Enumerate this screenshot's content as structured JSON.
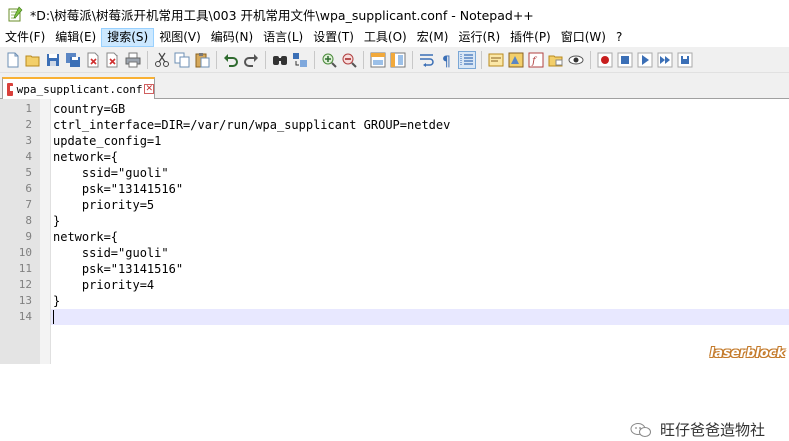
{
  "window": {
    "title": "*D:\\树莓派\\树莓派开机常用工具\\003 开机常用文件\\wpa_supplicant.conf - Notepad++"
  },
  "menu": {
    "items": [
      "文件(F)",
      "编辑(E)",
      "搜索(S)",
      "视图(V)",
      "编码(N)",
      "语言(L)",
      "设置(T)",
      "工具(O)",
      "宏(M)",
      "运行(R)",
      "插件(P)",
      "窗口(W)",
      "?"
    ],
    "active_index": 2
  },
  "toolbar": {
    "icons": [
      "new-file-icon",
      "open-file-icon",
      "save-icon",
      "save-all-icon",
      "close-icon",
      "close-all-icon",
      "print-icon",
      "cut-icon",
      "copy-icon",
      "paste-icon",
      "undo-icon",
      "redo-icon",
      "find-icon",
      "replace-icon",
      "zoom-in-icon",
      "zoom-out-icon",
      "sync-vertical-icon",
      "sync-horizontal-icon",
      "word-wrap-icon",
      "show-all-chars-icon",
      "indent-guide-icon",
      "language-icon",
      "doc-map-icon",
      "function-list-icon",
      "folder-workspace-icon",
      "monitor-icon",
      "record-macro-icon",
      "stop-macro-icon",
      "play-macro-icon",
      "run-macro-multiple-icon",
      "save-macro-icon"
    ]
  },
  "tab": {
    "label": "wpa_supplicant.conf",
    "close_glyph": "✕"
  },
  "editor": {
    "lines": [
      "country=GB",
      "ctrl_interface=DIR=/var/run/wpa_supplicant GROUP=netdev",
      "update_config=1",
      "network={",
      "    ssid=\"guoli\"",
      "    psk=\"13141516\"",
      "    priority=5",
      "}",
      "network={",
      "    ssid=\"guoli\"",
      "    psk=\"13141516\"",
      "    priority=4",
      "}",
      ""
    ],
    "line_numbers": [
      "1",
      "2",
      "3",
      "4",
      "5",
      "6",
      "7",
      "8",
      "9",
      "10",
      "11",
      "12",
      "13",
      "14"
    ],
    "current_line": 14
  },
  "watermark": {
    "text": "旺仔爸爸造物社",
    "brand": "laserblock"
  }
}
